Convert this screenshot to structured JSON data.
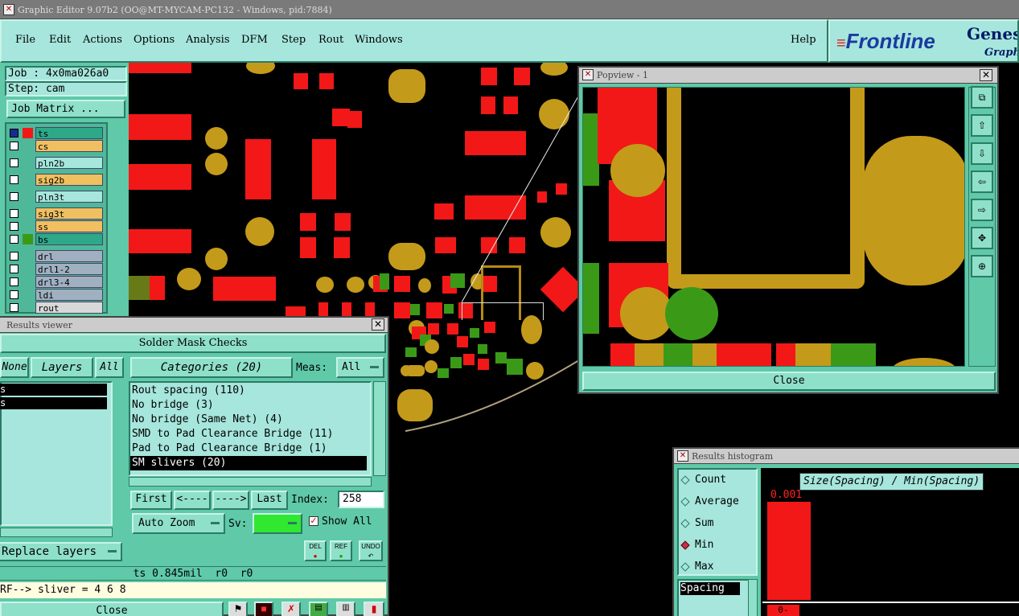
{
  "window": {
    "title": "Graphic Editor 9.07b2 (OO@MT-MYCAM-PC132 - Windows, pid:7884)"
  },
  "menu": [
    "File",
    "Edit",
    "Actions",
    "Options",
    "Analysis",
    "DFM",
    "Step",
    "Rout",
    "Windows"
  ],
  "help_label": "Help",
  "brand": {
    "logo": "Frontline",
    "product": "Genesi",
    "sub": "Graphi"
  },
  "job": {
    "job_label": "Job : 4x0ma026a0",
    "step_label": "Step: cam",
    "matrix_button": "Job Matrix ..."
  },
  "layers": [
    {
      "name": "ts",
      "color": "#2fa88a"
    },
    {
      "name": "cs",
      "color": "#f0c060"
    },
    {
      "name": "pln2b",
      "color": "#a6e6dc"
    },
    {
      "name": "sig2b",
      "color": "#f0c060"
    },
    {
      "name": "pln3t",
      "color": "#a6e6dc"
    },
    {
      "name": "sig3t",
      "color": "#f0c060"
    },
    {
      "name": "ss",
      "color": "#f0c060"
    },
    {
      "name": "bs",
      "color": "#2fa88a"
    },
    {
      "name": "drl",
      "color": "#a0b0c0"
    },
    {
      "name": "drl1-2",
      "color": "#a0b0c0"
    },
    {
      "name": "drl3-4",
      "color": "#a0b0c0"
    },
    {
      "name": "ldi",
      "color": "#a0b0c0"
    },
    {
      "name": "rout",
      "color": "#d8d8d8"
    }
  ],
  "results_viewer": {
    "title": "Results viewer",
    "heading": "Solder Mask Checks",
    "none_btn": "None",
    "layers_btn": "Layers",
    "all_btn": "All",
    "categories_btn": "Categories (20)",
    "meas_label": "Meas:",
    "meas_value": "All",
    "layer_list": [
      "s",
      "s"
    ],
    "categories": [
      "Rout spacing (110)",
      "No bridge (3)",
      "No bridge (Same Net) (4)",
      "SMD to Pad Clearance Bridge (11)",
      "Pad to Pad Clearance Bridge (1)",
      "SM slivers (20)"
    ],
    "selected_category": "SM slivers (20)",
    "nav": {
      "first": "First",
      "prev": "<----",
      "next": "---->",
      "last": "Last",
      "index_label": "Index:",
      "index_value": "258"
    },
    "auto_zoom": "Auto Zoom",
    "sv_label": "Sv:",
    "show_all": "Show All",
    "replace_layers": "Replace layers",
    "icons": [
      "DEL",
      "REF",
      "UNDO"
    ],
    "status": "ts 0.845mil  r0  r0",
    "message": "RF--> sliver = 4 6 8",
    "close": "Close"
  },
  "popview": {
    "title": "Popview - 1",
    "close": "Close"
  },
  "histogram": {
    "title": "Results histogram",
    "options": [
      "Count",
      "Average",
      "Sum",
      "Min",
      "Max"
    ],
    "selected": "Min",
    "spacing_item": "Spacing",
    "axis_title": "Size(Spacing) / Min(Spacing)",
    "bar_label": "0.001",
    "bottom_label": "0-",
    "bar_fill": 1.0
  },
  "colors": {
    "accent": "#5fc9a8",
    "pad_red": "#f21818",
    "pad_gold": "#c49a1a",
    "pad_green": "#3a9a18"
  }
}
